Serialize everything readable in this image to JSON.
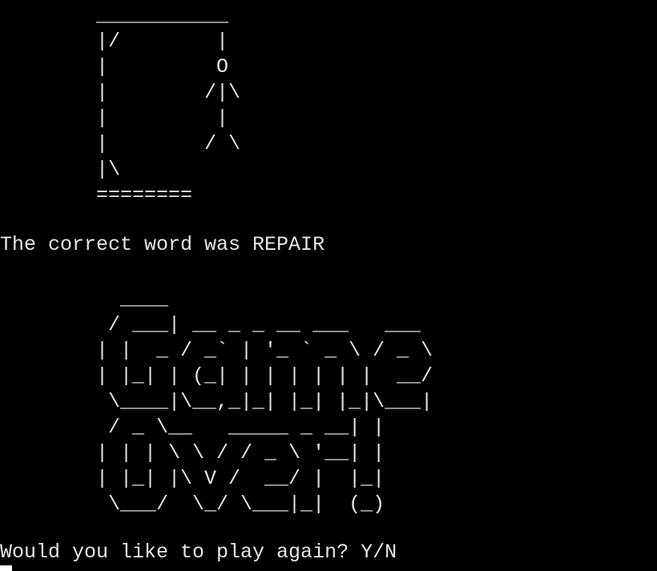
{
  "terminal": {
    "hangman_art": "        ___________\n        |/        |\n        |         O\n        |        /|\\\n        |         |\n        |        / \\\n        |\\\n        ========",
    "result_message": "The correct word was REPAIR",
    "game_over_banner": "          ____\n         / ___| __ _ _ __ ___   ___\n        | |  _ / _` | '_ ` _ \\ / _ \\\n        | |_| | (_| | | | | | |  __/\n         \\____|\\__,_|_| |_| |_|\\___|\n         / _ \\__   _____ _ __| |\n        | | | \\ \\ / / _ \\ '__| |\n        | |_| |\\ V /  __/ |  |_|\n         \\___/  \\_/ \\___|_|  (_)",
    "play_again_prompt": "Would you like to play again? Y/N"
  },
  "colors": {
    "background": "#000000",
    "foreground": "#e6e6e6",
    "cursor": "#ffffff"
  }
}
